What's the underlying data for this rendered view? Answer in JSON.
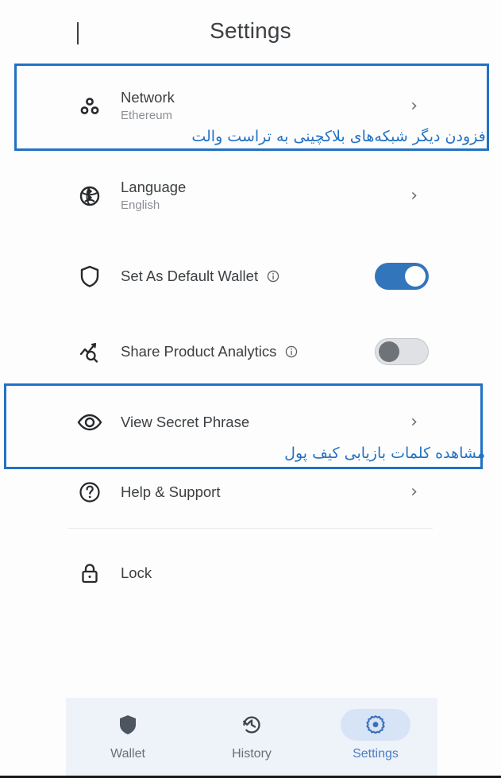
{
  "header": {
    "title": "Settings",
    "back_icon": "back-caret-icon"
  },
  "settings_rows": [
    {
      "id": "network",
      "icon": "network-nodes-icon",
      "title": "Network",
      "subtitle": "Ethereum",
      "accessory": "chevron-right",
      "chevron": "›"
    },
    {
      "id": "language",
      "icon": "globe-icon",
      "title": "Language",
      "subtitle": "English",
      "accessory": "chevron-right",
      "chevron": "›"
    },
    {
      "id": "default-wallet",
      "icon": "shield-icon",
      "title": "Set As Default Wallet",
      "subtitle": "",
      "accessory": "toggle",
      "toggle_state": "on",
      "has_info": true
    },
    {
      "id": "share-analytics",
      "icon": "analytics-search-icon",
      "title": "Share Product Analytics",
      "subtitle": "",
      "accessory": "toggle",
      "toggle_state": "off",
      "has_info": true
    },
    {
      "id": "view-secret-phrase",
      "icon": "eye-icon",
      "title": "View Secret Phrase",
      "subtitle": "",
      "accessory": "chevron-right",
      "chevron": "›"
    },
    {
      "id": "help-support",
      "icon": "question-circle-icon",
      "title": "Help & Support",
      "subtitle": "",
      "accessory": "chevron-right",
      "chevron": "›"
    },
    {
      "id": "lock",
      "icon": "lock-icon",
      "title": "Lock",
      "subtitle": "",
      "accessory": "none"
    }
  ],
  "annotations": [
    {
      "id": "network-annotation",
      "text": "افزودن دیگر شبکه‌های بلاکچینی به تراست والت",
      "color": "#2272c4"
    },
    {
      "id": "secret-phrase-annotation",
      "text": "مشاهده کلمات بازیابی کیف پول",
      "color": "#2272c4"
    }
  ],
  "bottom_nav": {
    "items": [
      {
        "id": "wallet",
        "icon": "shield-filled-icon",
        "label": "Wallet",
        "active": false
      },
      {
        "id": "history",
        "icon": "clock-history-icon",
        "label": "History",
        "active": false
      },
      {
        "id": "settings",
        "icon": "gear-icon",
        "label": "Settings",
        "active": true
      }
    ]
  },
  "colors": {
    "accent": "#3375bb",
    "annotation": "#2272c4",
    "nav_active_pill": "#d7e3f7",
    "nav_bg": "#eef2f9",
    "toggle_off_track": "#dfe1e5",
    "toggle_off_knob": "#6e7378",
    "text_primary": "#3c4043",
    "text_secondary": "#8a8f95"
  }
}
